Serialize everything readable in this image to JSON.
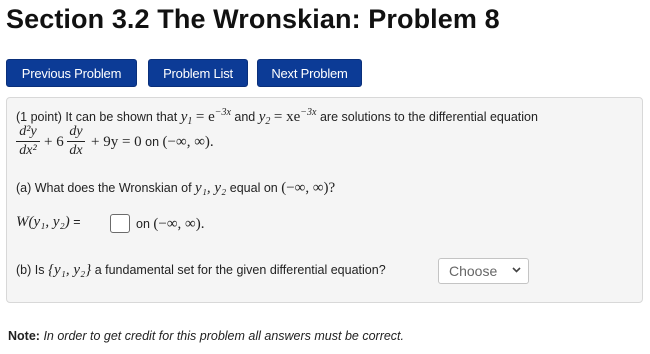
{
  "page": {
    "title": "Section 3.2 The Wronskian: Problem 8"
  },
  "nav": {
    "previous_label": "Previous Problem",
    "list_label": "Problem List",
    "next_label": "Next Problem"
  },
  "problem": {
    "intro": "(1 point) It can be shown that",
    "y1": "y",
    "eq_y1": "= e",
    "exp": "−3x",
    "and": "and",
    "eq_y2": "= xe",
    "solutions_text": "are solutions to the differential equation",
    "d2y": "d²y",
    "dx2": "dx²",
    "plus6": "+ 6",
    "dy": "dy",
    "dx": "dx",
    "plus9y": "+ 9y = 0",
    "on": "on",
    "interval": "(−∞, ∞).",
    "part_a": "(a) What does the Wronskian of",
    "part_a_vars": "y₁, y₂",
    "part_a_eq": "equal on",
    "part_a_interval": "(−∞, ∞)?",
    "wronskian_label": "W(y₁, y₂)",
    "equals": "=",
    "answer_value": "",
    "on_after_box": "on",
    "interval_after_box": "(−∞, ∞).",
    "part_b": "(b) Is",
    "part_b_set": "{y₁, y₂}",
    "part_b_rest": "a fundamental set for the given differential equation?",
    "select_value": "Choose"
  },
  "note": {
    "label": "Note:",
    "text": "In order to get credit for this problem all answers must be correct."
  },
  "icons": {
    "select_arrow": "chevron-down-icon"
  },
  "colors": {
    "button_bg": "#0c3b96",
    "panel_bg": "#f5f5f5"
  }
}
